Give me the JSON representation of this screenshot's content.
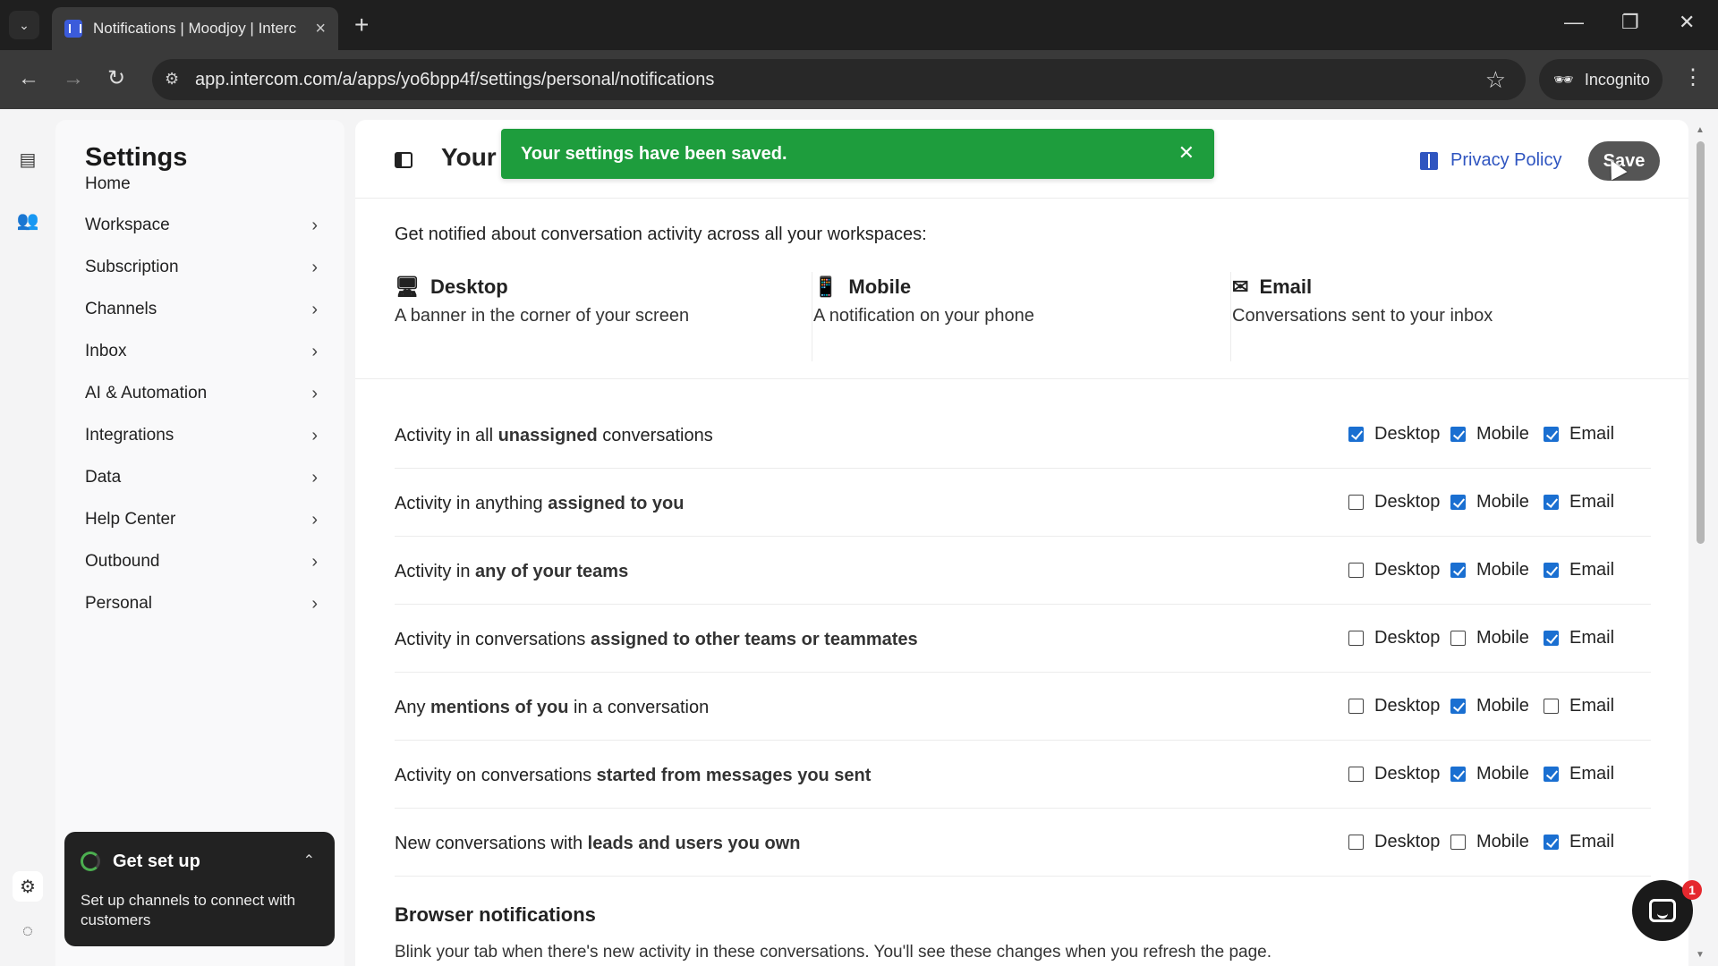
{
  "browser": {
    "tab_title": "Notifications | Moodjoy | Interc",
    "url": "app.intercom.com/a/apps/yo6bpp4f/settings/personal/notifications",
    "profile_label": "Incognito"
  },
  "sidebar": {
    "title": "Settings",
    "items": [
      {
        "label": "Home",
        "chevron": false
      },
      {
        "label": "Workspace",
        "chevron": true
      },
      {
        "label": "Subscription",
        "chevron": true
      },
      {
        "label": "Channels",
        "chevron": true
      },
      {
        "label": "Inbox",
        "chevron": true
      },
      {
        "label": "AI & Automation",
        "chevron": true
      },
      {
        "label": "Integrations",
        "chevron": true
      },
      {
        "label": "Data",
        "chevron": true
      },
      {
        "label": "Help Center",
        "chevron": true
      },
      {
        "label": "Outbound",
        "chevron": true
      },
      {
        "label": "Personal",
        "chevron": true
      }
    ],
    "setup_card": {
      "title": "Get set up",
      "description": "Set up channels to connect with customers"
    }
  },
  "header": {
    "title": "Your",
    "privacy_link": "Privacy Policy",
    "save_label": "Save"
  },
  "toast": {
    "message": "Your settings have been saved."
  },
  "intro": "Get notified about conversation activity across all your workspaces:",
  "channels": [
    {
      "name": "Desktop",
      "description": "A banner in the corner of your screen",
      "icon": "monitor-icon"
    },
    {
      "name": "Mobile",
      "description": "A notification on your phone",
      "icon": "phone-icon"
    },
    {
      "name": "Email",
      "description": "Conversations sent to your inbox",
      "icon": "envelope-icon"
    }
  ],
  "option_labels": {
    "desktop": "Desktop",
    "mobile": "Mobile",
    "email": "Email"
  },
  "rows": [
    {
      "pre": "Activity in all ",
      "bold": "unassigned",
      "post": " conversations",
      "desktop": true,
      "mobile": true,
      "email": true
    },
    {
      "pre": "Activity in anything ",
      "bold": "assigned to you",
      "post": "",
      "desktop": false,
      "mobile": true,
      "email": true
    },
    {
      "pre": "Activity in ",
      "bold": "any of your teams",
      "post": "",
      "desktop": false,
      "mobile": true,
      "email": true
    },
    {
      "pre": "Activity in conversations ",
      "bold": "assigned to other teams or teammates",
      "post": "",
      "desktop": false,
      "mobile": false,
      "email": true
    },
    {
      "pre": "Any ",
      "bold": "mentions of you",
      "post": " in a conversation",
      "desktop": false,
      "mobile": true,
      "email": false
    },
    {
      "pre": "Activity on conversations ",
      "bold": "started from messages you sent",
      "post": "",
      "desktop": false,
      "mobile": true,
      "email": true
    },
    {
      "pre": "New conversations with ",
      "bold": "leads and users you own",
      "post": "",
      "desktop": false,
      "mobile": false,
      "email": true
    }
  ],
  "browser_notifications": {
    "title": "Browser notifications",
    "description": "Blink your tab when there's new activity in these conversations. You'll see these changes when you refresh the page."
  },
  "messenger_badge": "1",
  "colors": {
    "toast_bg": "#1e9d3d",
    "link": "#2f55c0",
    "checkbox_on": "#1a6fd1",
    "badge": "#e5282e"
  }
}
